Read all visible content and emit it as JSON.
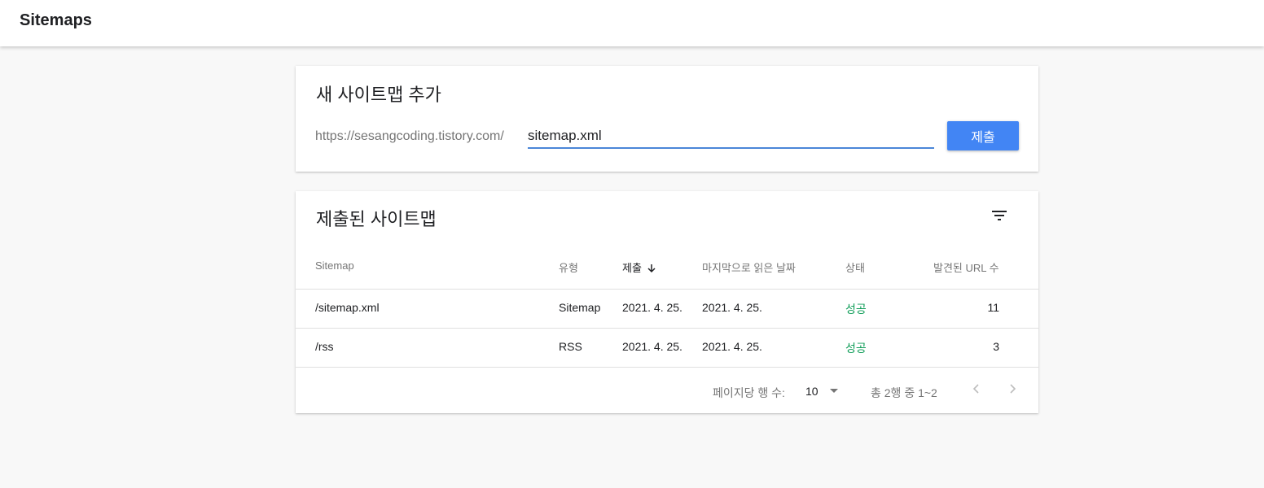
{
  "header": {
    "title": "Sitemaps"
  },
  "add_card": {
    "title": "새 사이트맵 추가",
    "url_prefix": "https://sesangcoding.tistory.com/",
    "input_value": "sitemap.xml",
    "submit_label": "제출"
  },
  "list_card": {
    "title": "제출된 사이트맵",
    "columns": {
      "sitemap": "Sitemap",
      "type": "유형",
      "submitted": "제출",
      "last_read": "마지막으로 읽은 날짜",
      "status": "상태",
      "urls_found": "발견된 URL 수"
    },
    "rows": [
      {
        "sitemap": "/sitemap.xml",
        "type": "Sitemap",
        "submitted": "2021. 4. 25.",
        "last_read": "2021. 4. 25.",
        "status": "성공",
        "urls_found": "11"
      },
      {
        "sitemap": "/rss",
        "type": "RSS",
        "submitted": "2021. 4. 25.",
        "last_read": "2021. 4. 25.",
        "status": "성공",
        "urls_found": "3"
      }
    ],
    "pagination": {
      "rows_per_page_label": "페이지당 행 수:",
      "rows_per_page_value": "10",
      "range_text": "총 2행 중 1~2"
    }
  },
  "colors": {
    "accent": "#4285f4",
    "input_underline": "#4a86d8",
    "success": "#0f9d58"
  },
  "icons": [
    "filter-icon",
    "arrow-down-icon",
    "caret-down-icon",
    "chevron-left-icon",
    "chevron-right-icon"
  ]
}
